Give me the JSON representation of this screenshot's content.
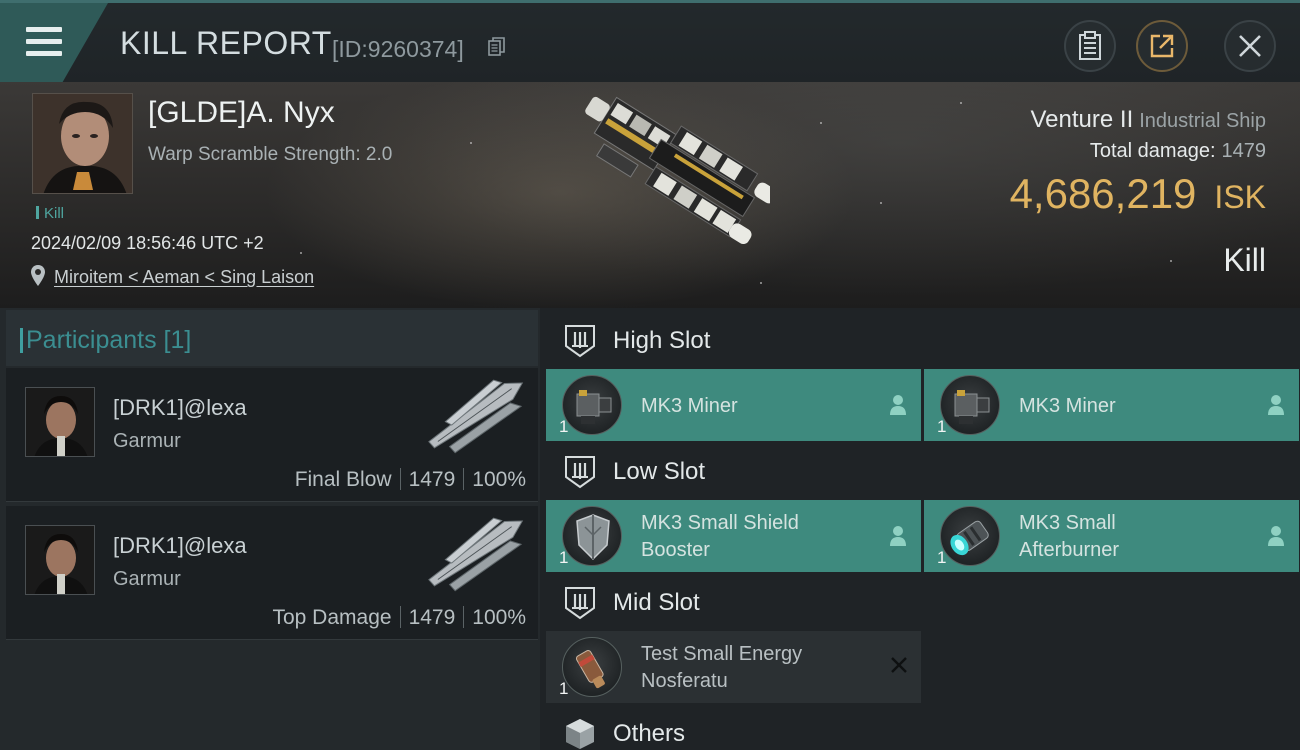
{
  "header": {
    "title": "KILL REPORT",
    "report_id": "[ID:9260374]"
  },
  "victim": {
    "name": "[GLDE]A. Nyx",
    "warp_scramble": "Warp Scramble Strength: 2.0",
    "tag": "Kill",
    "datetime": "2024/02/09 18:56:46 UTC +2",
    "location": "Miroitem < Aeman < Sing Laison",
    "ship_name": "Venture II",
    "ship_class": "Industrial Ship",
    "total_damage_label": "Total damage:",
    "total_damage": "1479",
    "isk_value": "4,686,219",
    "isk_unit": "ISK",
    "result": "Kill"
  },
  "participants": {
    "label": "Participants [1]",
    "items": [
      {
        "name": "[DRK1]@lexa",
        "ship": "Garmur",
        "role": "Final Blow",
        "damage": "1479",
        "percent": "100%"
      },
      {
        "name": "[DRK1]@lexa",
        "ship": "Garmur",
        "role": "Top Damage",
        "damage": "1479",
        "percent": "100%"
      }
    ]
  },
  "fitting": {
    "high_slot": {
      "label": "High Slot",
      "modules": [
        {
          "name_line1": "MK3 Miner",
          "name_line2": "",
          "qty": "1",
          "state": "dropped"
        },
        {
          "name_line1": "MK3 Miner",
          "name_line2": "",
          "qty": "1",
          "state": "dropped"
        }
      ]
    },
    "low_slot": {
      "label": "Low Slot",
      "modules": [
        {
          "name_line1": "MK3 Small Shield",
          "name_line2": "Booster",
          "qty": "1",
          "state": "dropped"
        },
        {
          "name_line1": "MK3 Small",
          "name_line2": "Afterburner",
          "qty": "1",
          "state": "dropped"
        }
      ]
    },
    "mid_slot": {
      "label": "Mid Slot",
      "modules": [
        {
          "name_line1": "Test Small Energy",
          "name_line2": "Nosferatu",
          "qty": "1",
          "state": "destroyed"
        }
      ]
    },
    "others": {
      "label": "Others"
    }
  },
  "colors": {
    "accent_teal": "#3e8a7e",
    "isk_gold": "#e0b461",
    "participants_teal": "#3b8e91"
  },
  "icons": [
    "menu-icon",
    "copy-icon",
    "clipboard-icon",
    "share-icon",
    "close-icon",
    "pin-icon",
    "slot-icon",
    "pilot-icon",
    "x-icon",
    "cube-icon"
  ]
}
